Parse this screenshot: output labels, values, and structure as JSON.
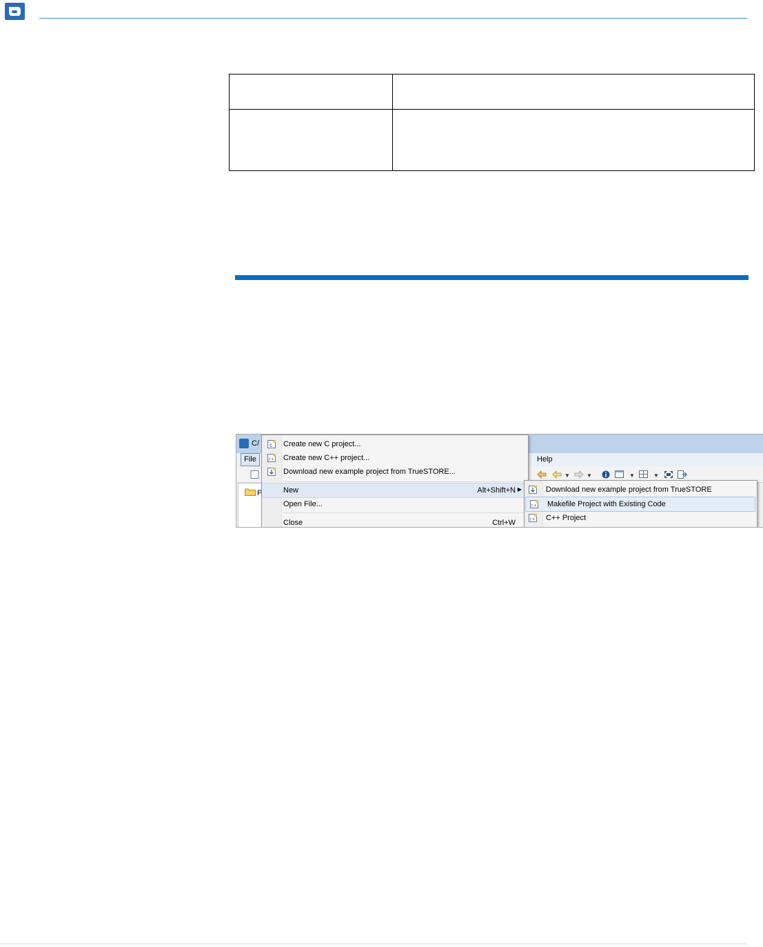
{
  "menu": {
    "create_c": "Create new C project...",
    "create_cpp": "Create new C++ project...",
    "download_example": "Download new example project from TrueSTORE...",
    "new": "New",
    "new_shortcut": "Alt+Shift+N",
    "open_file": "Open File...",
    "close": "Close",
    "close_shortcut": "Ctrl+W"
  },
  "submenu": {
    "download_example": "Download new example project from TrueSTORE",
    "makefile_project": "Makefile Project with Existing Code",
    "cpp_project": "C++ Project"
  },
  "menubar": {
    "file": "File",
    "help": "Help"
  },
  "window": {
    "title_fragment": "C/",
    "pane_letter": "P"
  },
  "colors": {
    "accent": "#2a6cb3",
    "section_rule": "#0a6cc0",
    "titlebar": "#bcd3ea"
  }
}
